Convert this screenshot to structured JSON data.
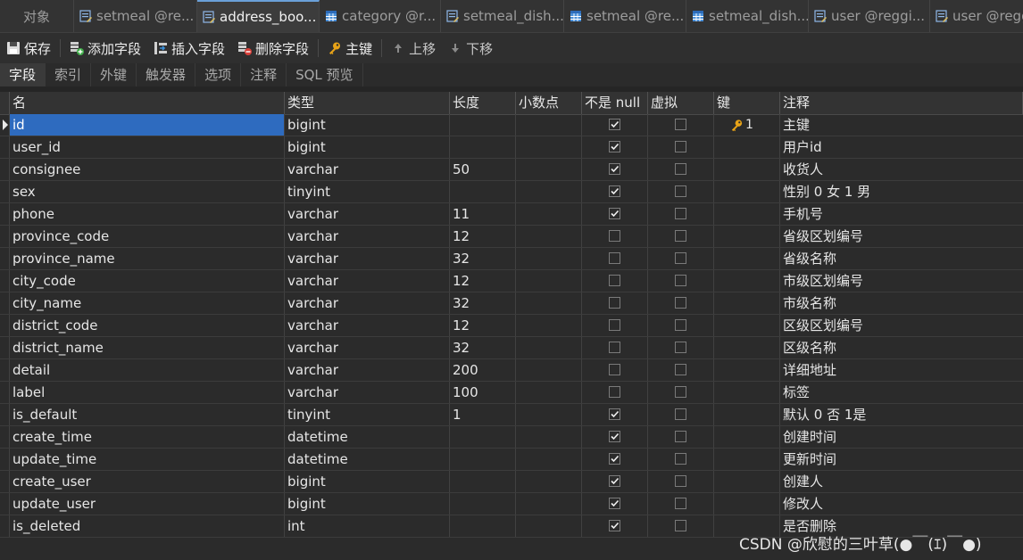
{
  "tabs": [
    {
      "label": "对象",
      "icon": "none",
      "active": false
    },
    {
      "label": "setmeal @re...",
      "icon": "table-design-icon",
      "active": false
    },
    {
      "label": "address_boo...",
      "icon": "table-design-icon",
      "active": true
    },
    {
      "label": "category @r...",
      "icon": "table-grid-icon",
      "active": false
    },
    {
      "label": "setmeal_dish...",
      "icon": "table-design-icon",
      "active": false
    },
    {
      "label": "setmeal @re...",
      "icon": "table-grid-icon",
      "active": false
    },
    {
      "label": "setmeal_dish...",
      "icon": "table-grid-icon",
      "active": false
    },
    {
      "label": "user @reggi...",
      "icon": "table-design-icon",
      "active": false
    },
    {
      "label": "user @regg",
      "icon": "table-design-icon",
      "active": false
    }
  ],
  "toolbar": {
    "save": "保存",
    "add_field": "添加字段",
    "insert_field": "插入字段",
    "delete_field": "删除字段",
    "primary_key": "主键",
    "move_up": "上移",
    "move_down": "下移"
  },
  "subtabs": [
    "字段",
    "索引",
    "外键",
    "触发器",
    "选项",
    "注释",
    "SQL 预览"
  ],
  "columns": [
    "名",
    "类型",
    "长度",
    "小数点",
    "不是 null",
    "虚拟",
    "键",
    "注释"
  ],
  "rows": [
    {
      "name": "id",
      "type": "bigint",
      "length": "",
      "decimals": "",
      "not_null": true,
      "virtual": false,
      "key": "1",
      "comment": "主键"
    },
    {
      "name": "user_id",
      "type": "bigint",
      "length": "",
      "decimals": "",
      "not_null": true,
      "virtual": false,
      "key": "",
      "comment": "用户id"
    },
    {
      "name": "consignee",
      "type": "varchar",
      "length": "50",
      "decimals": "",
      "not_null": true,
      "virtual": false,
      "key": "",
      "comment": "收货人"
    },
    {
      "name": "sex",
      "type": "tinyint",
      "length": "",
      "decimals": "",
      "not_null": true,
      "virtual": false,
      "key": "",
      "comment": "性别 0 女 1 男"
    },
    {
      "name": "phone",
      "type": "varchar",
      "length": "11",
      "decimals": "",
      "not_null": true,
      "virtual": false,
      "key": "",
      "comment": "手机号"
    },
    {
      "name": "province_code",
      "type": "varchar",
      "length": "12",
      "decimals": "",
      "not_null": false,
      "virtual": false,
      "key": "",
      "comment": "省级区划编号"
    },
    {
      "name": "province_name",
      "type": "varchar",
      "length": "32",
      "decimals": "",
      "not_null": false,
      "virtual": false,
      "key": "",
      "comment": "省级名称"
    },
    {
      "name": "city_code",
      "type": "varchar",
      "length": "12",
      "decimals": "",
      "not_null": false,
      "virtual": false,
      "key": "",
      "comment": "市级区划编号"
    },
    {
      "name": "city_name",
      "type": "varchar",
      "length": "32",
      "decimals": "",
      "not_null": false,
      "virtual": false,
      "key": "",
      "comment": "市级名称"
    },
    {
      "name": "district_code",
      "type": "varchar",
      "length": "12",
      "decimals": "",
      "not_null": false,
      "virtual": false,
      "key": "",
      "comment": "区级区划编号"
    },
    {
      "name": "district_name",
      "type": "varchar",
      "length": "32",
      "decimals": "",
      "not_null": false,
      "virtual": false,
      "key": "",
      "comment": "区级名称"
    },
    {
      "name": "detail",
      "type": "varchar",
      "length": "200",
      "decimals": "",
      "not_null": false,
      "virtual": false,
      "key": "",
      "comment": "详细地址"
    },
    {
      "name": "label",
      "type": "varchar",
      "length": "100",
      "decimals": "",
      "not_null": false,
      "virtual": false,
      "key": "",
      "comment": "标签"
    },
    {
      "name": "is_default",
      "type": "tinyint",
      "length": "1",
      "decimals": "",
      "not_null": true,
      "virtual": false,
      "key": "",
      "comment": "默认 0 否 1是"
    },
    {
      "name": "create_time",
      "type": "datetime",
      "length": "",
      "decimals": "",
      "not_null": true,
      "virtual": false,
      "key": "",
      "comment": "创建时间"
    },
    {
      "name": "update_time",
      "type": "datetime",
      "length": "",
      "decimals": "",
      "not_null": true,
      "virtual": false,
      "key": "",
      "comment": "更新时间"
    },
    {
      "name": "create_user",
      "type": "bigint",
      "length": "",
      "decimals": "",
      "not_null": true,
      "virtual": false,
      "key": "",
      "comment": "创建人"
    },
    {
      "name": "update_user",
      "type": "bigint",
      "length": "",
      "decimals": "",
      "not_null": true,
      "virtual": false,
      "key": "",
      "comment": "修改人"
    },
    {
      "name": "is_deleted",
      "type": "int",
      "length": "",
      "decimals": "",
      "not_null": true,
      "virtual": false,
      "key": "",
      "comment": "是否删除"
    }
  ],
  "watermark": "CSDN @欣慰的三叶草(●￣(ｴ)￣●)",
  "colors": {
    "selection": "#2e6bbf",
    "background": "#2b2b2b",
    "key_icon": "#e8a317",
    "tab_accent": "#6aa0d8"
  }
}
